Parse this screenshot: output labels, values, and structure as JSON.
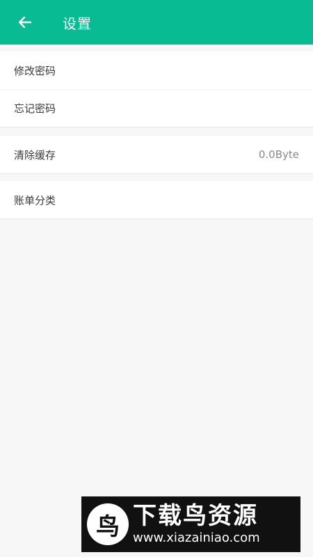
{
  "header": {
    "title": "设置",
    "back_icon": "arrow-left-icon"
  },
  "groups": [
    {
      "items": [
        {
          "label": "修改密码"
        },
        {
          "label": "忘记密码"
        }
      ]
    },
    {
      "items": [
        {
          "label": "清除缓存",
          "value": "0.0Byte"
        }
      ]
    },
    {
      "items": [
        {
          "label": "账单分类"
        }
      ]
    }
  ],
  "watermark": {
    "logo_char": "鸟",
    "title": "下载鸟资源",
    "url": "www.xiazainiao.com"
  },
  "colors": {
    "accent": "#08bb93",
    "background": "#f7f7f7"
  }
}
